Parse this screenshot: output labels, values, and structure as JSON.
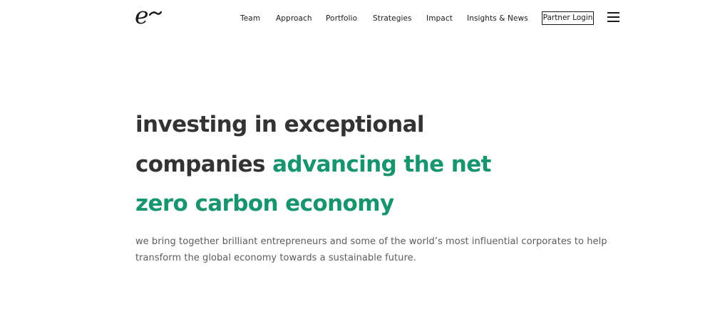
{
  "logo": {
    "letter": "e"
  },
  "nav": {
    "items": [
      {
        "label": "Team"
      },
      {
        "label": "Approach"
      },
      {
        "label": "Portfolio"
      },
      {
        "label": "Strategies"
      },
      {
        "label": "Impact"
      },
      {
        "label": "Insights & News"
      }
    ],
    "partner_login": "Partner Login"
  },
  "hero": {
    "headline_line1": "investing in exceptional",
    "headline_line2_dark": "companies ",
    "headline_line2_accent": "advancing the net",
    "headline_line3_accent": "zero carbon economy",
    "subtext": "we bring together brilliant entrepreneurs and some of the world’s most influential corporates to help transform the global economy towards a sustainable future."
  },
  "colors": {
    "accent": "#17956e",
    "heading": "#333333",
    "body_text": "#5c5c5c",
    "nav_text": "#1a1a1a",
    "background": "#ffffff"
  },
  "icons": {
    "logo": "e-logo-icon",
    "menu": "hamburger-menu-icon"
  }
}
